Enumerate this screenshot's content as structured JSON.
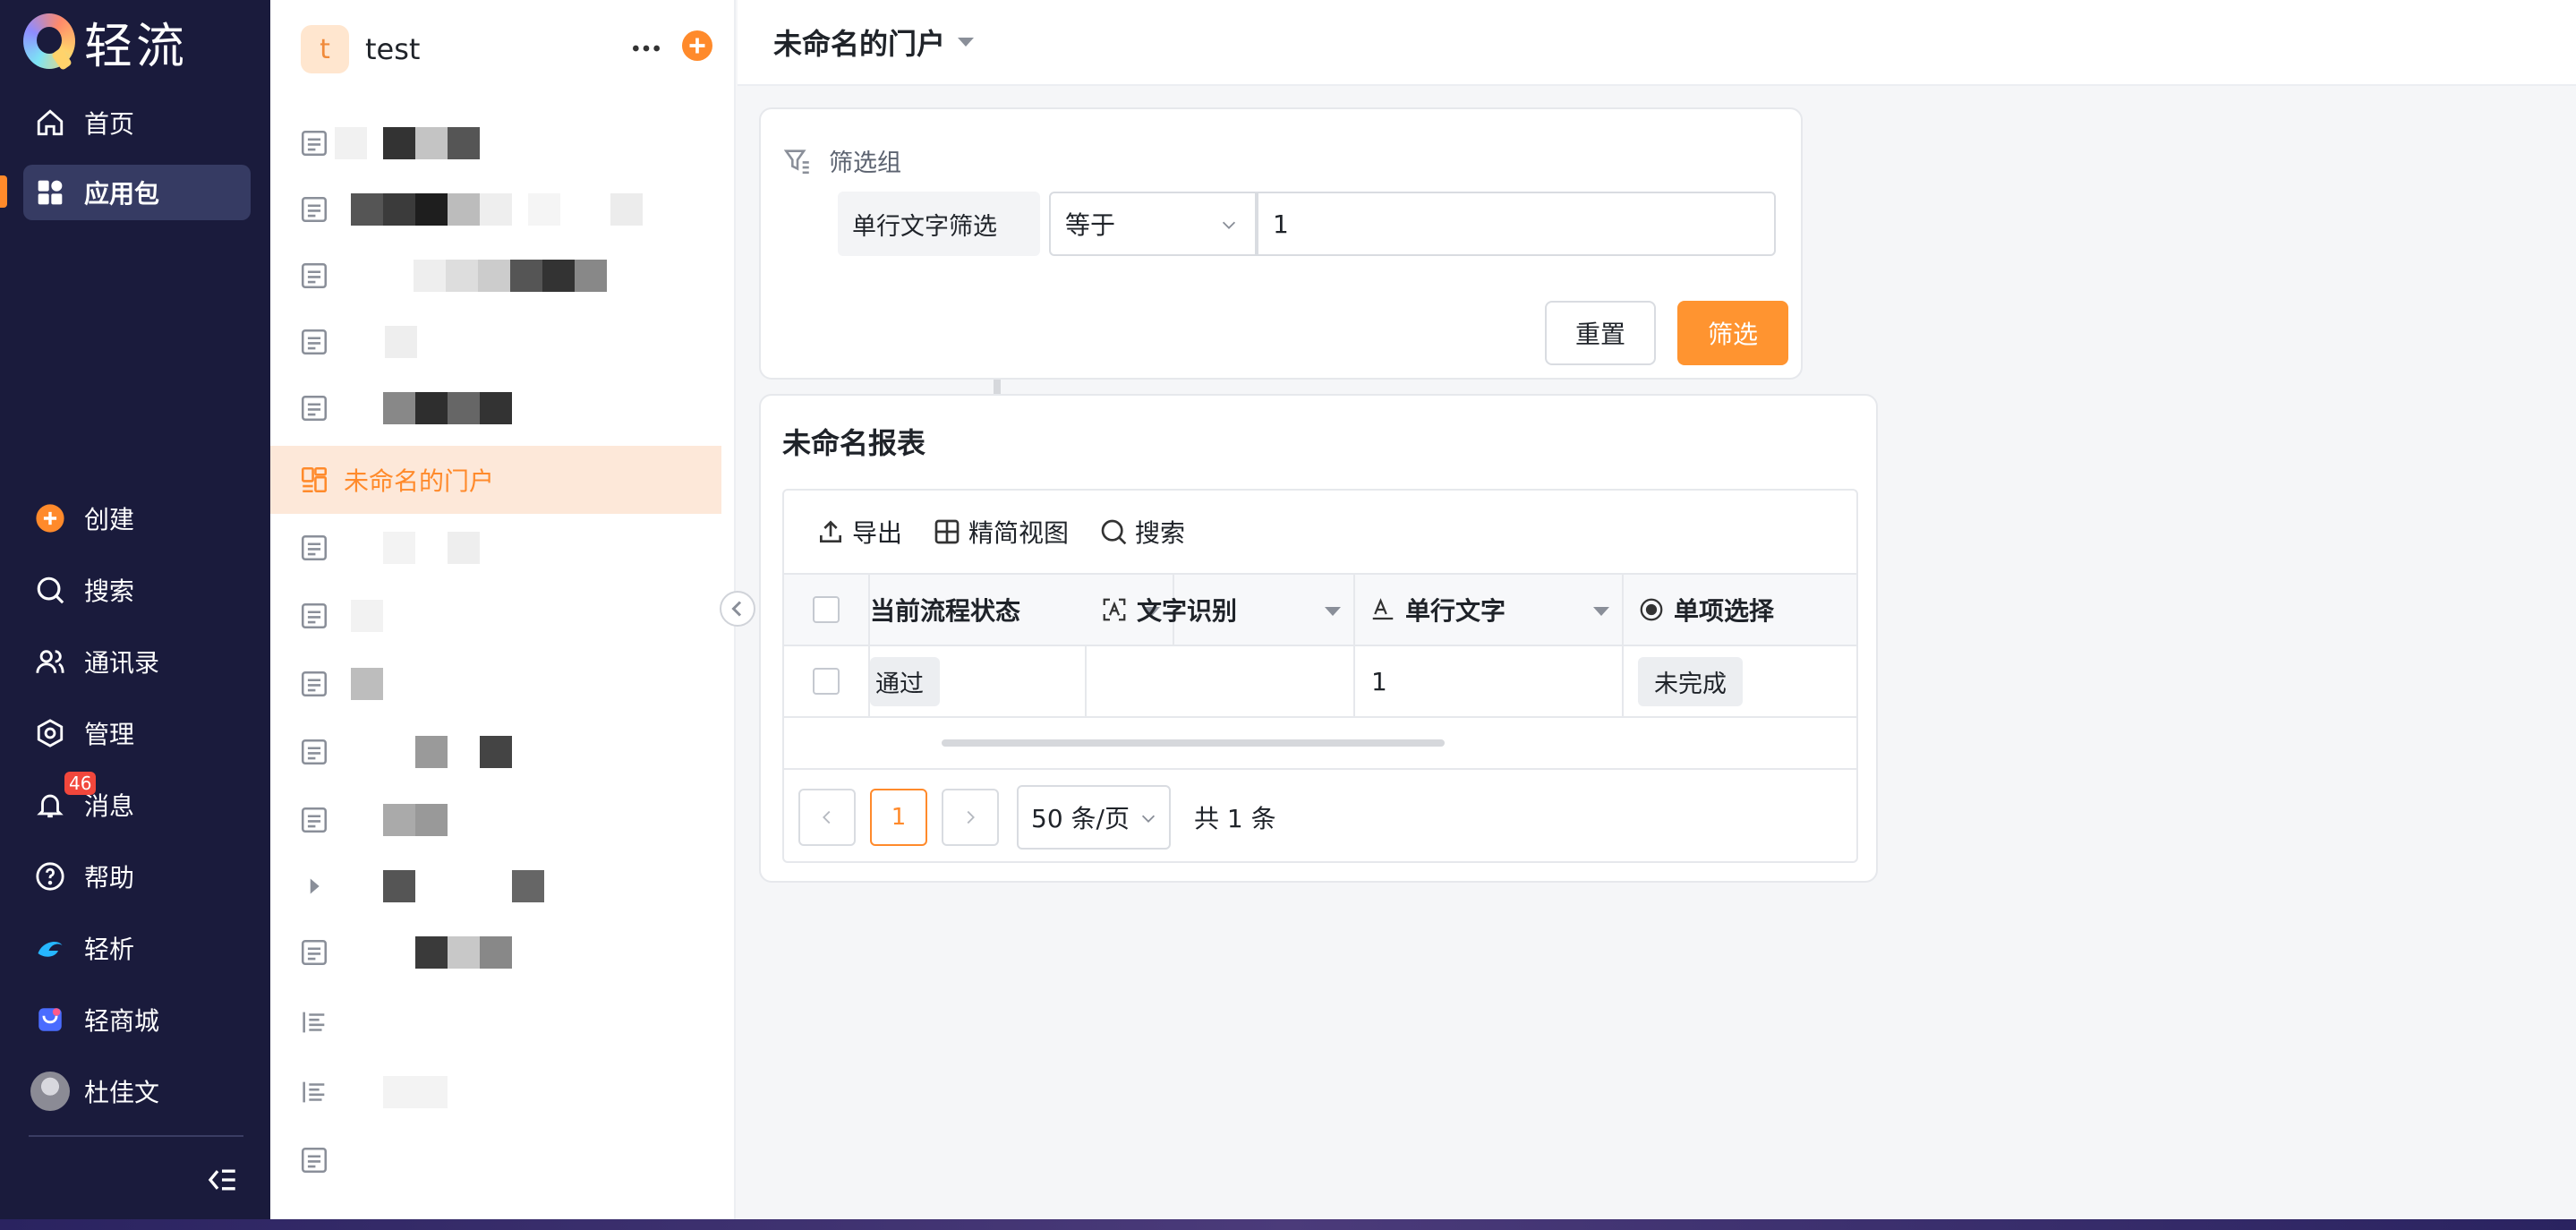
{
  "app": {
    "brand": "轻流"
  },
  "nav": {
    "items": [
      {
        "label": "首页",
        "icon": "home-icon"
      },
      {
        "label": "应用包",
        "icon": "grid-icon",
        "active": true
      },
      {
        "label": "创建",
        "icon": "plus-circle-icon"
      },
      {
        "label": "搜索",
        "icon": "search-icon"
      },
      {
        "label": "通讯录",
        "icon": "contacts-icon"
      },
      {
        "label": "管理",
        "icon": "settings-icon"
      },
      {
        "label": "消息",
        "icon": "bell-icon",
        "badge": "46"
      },
      {
        "label": "帮助",
        "icon": "help-icon"
      },
      {
        "label": "轻析",
        "icon": "qingxi-logo-icon"
      },
      {
        "label": "轻商城",
        "icon": "store-icon"
      },
      {
        "label": "杜佳文",
        "icon": "avatar"
      }
    ],
    "accent": "#ff8a2b"
  },
  "workspace": {
    "avatar_letter": "t",
    "name": "test",
    "active_item": "未命名的门户"
  },
  "page": {
    "title": "未命名的门户"
  },
  "filter": {
    "group_title": "筛选组",
    "field_label": "单行文字筛选",
    "operator": "等于",
    "value": "1",
    "reset_label": "重置",
    "submit_label": "筛选"
  },
  "report": {
    "title": "未命名报表",
    "toolbar": {
      "export": "导出",
      "compact_view": "精简视图",
      "search": "搜索"
    },
    "columns": [
      "当前流程状态",
      "文字识别",
      "单行文字",
      "单项选择"
    ],
    "rows": [
      {
        "status": "通过",
        "ocr": "",
        "text": "1",
        "choice": "未完成"
      }
    ],
    "pagination": {
      "current_page": "1",
      "page_size": "50 条/页",
      "total": "共 1 条"
    }
  }
}
